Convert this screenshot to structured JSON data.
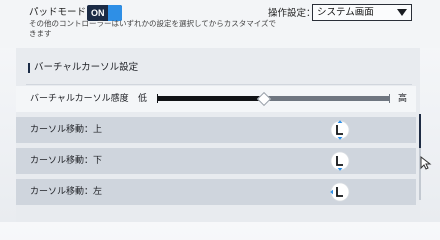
{
  "header": {
    "pad_mode_label": "パッドモード",
    "toggle_state": "ON",
    "pad_mode_description": "その他のコントローラーはいずれかの設定を選択してからカスタマイズできます",
    "operation_label": "操作設定：",
    "operation_value": "システム画面"
  },
  "section": {
    "title": "バーチャルカーソル設定"
  },
  "sensitivity": {
    "label": "バーチャルカーソル感度",
    "low_label": "低",
    "high_label": "高",
    "value_fraction": 0.46
  },
  "rows": [
    {
      "label": "カーソル移動：上",
      "icon": "left-stick-up-icon"
    },
    {
      "label": "カーソル移動：下",
      "icon": "left-stick-down-icon"
    },
    {
      "label": "カーソル移動：左",
      "icon": "left-stick-left-icon"
    }
  ],
  "colors": {
    "accent_blue": "#2e8fe6",
    "dark_navy": "#1b2b45",
    "row_background": "#cfd5dd"
  }
}
